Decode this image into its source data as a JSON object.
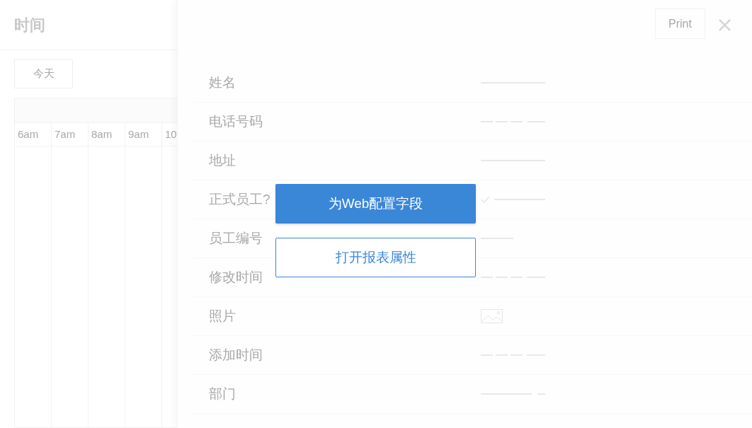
{
  "page": {
    "title": "时间",
    "today_button": "今天",
    "hours": [
      "6am",
      "7am",
      "8am",
      "9am",
      "10"
    ]
  },
  "panel": {
    "print_button": "Print",
    "fields": [
      {
        "label": "姓名",
        "kind": "text"
      },
      {
        "label": "电话号码",
        "kind": "phone"
      },
      {
        "label": "地址",
        "kind": "text"
      },
      {
        "label": "正式员工?",
        "kind": "check"
      },
      {
        "label": "员工编号",
        "kind": "number"
      },
      {
        "label": "修改时间",
        "kind": "datetime"
      },
      {
        "label": "照片",
        "kind": "image"
      },
      {
        "label": "添加时间",
        "kind": "datetime"
      },
      {
        "label": "部门",
        "kind": "select"
      }
    ]
  },
  "overlay": {
    "primary_button": "为Web配置字段",
    "secondary_button": "打开报表属性"
  }
}
